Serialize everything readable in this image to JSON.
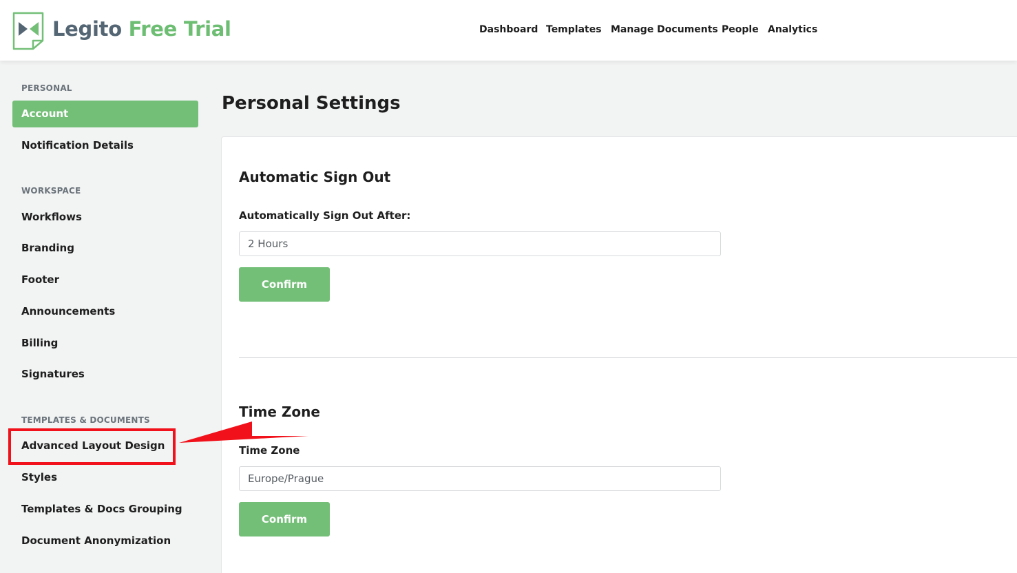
{
  "header": {
    "logo_brand": "Legito",
    "logo_sub": "Free Trial",
    "nav": [
      "Dashboard",
      "Templates",
      "Manage Documents",
      "People",
      "Analytics"
    ]
  },
  "sidebar": {
    "sections": [
      {
        "label": "PERSONAL",
        "items": [
          "Account",
          "Notification Details"
        ],
        "active": "Account"
      },
      {
        "label": "WORKSPACE",
        "items": [
          "Workflows",
          "Branding",
          "Footer",
          "Announcements",
          "Billing",
          "Signatures"
        ]
      },
      {
        "label": "TEMPLATES & DOCUMENTS",
        "items": [
          "Advanced Layout Design",
          "Styles",
          "Templates & Docs Grouping",
          "Document Anonymization"
        ],
        "highlighted": "Advanced Layout Design"
      }
    ]
  },
  "main": {
    "page_title": "Personal Settings",
    "sign_out": {
      "title": "Automatic Sign Out",
      "label": "Automatically Sign Out After:",
      "value": "2 Hours",
      "button": "Confirm"
    },
    "time_zone": {
      "title": "Time Zone",
      "label": "Time Zone",
      "value": "Europe/Prague",
      "button": "Confirm"
    }
  },
  "colors": {
    "accent_green": "#74bf78",
    "brand_slate": "#546674",
    "annotation_red": "#f0111a"
  },
  "icons": {
    "logo": "legito-bowtie-logo-icon",
    "annotation": "red-arrow-annotation"
  }
}
